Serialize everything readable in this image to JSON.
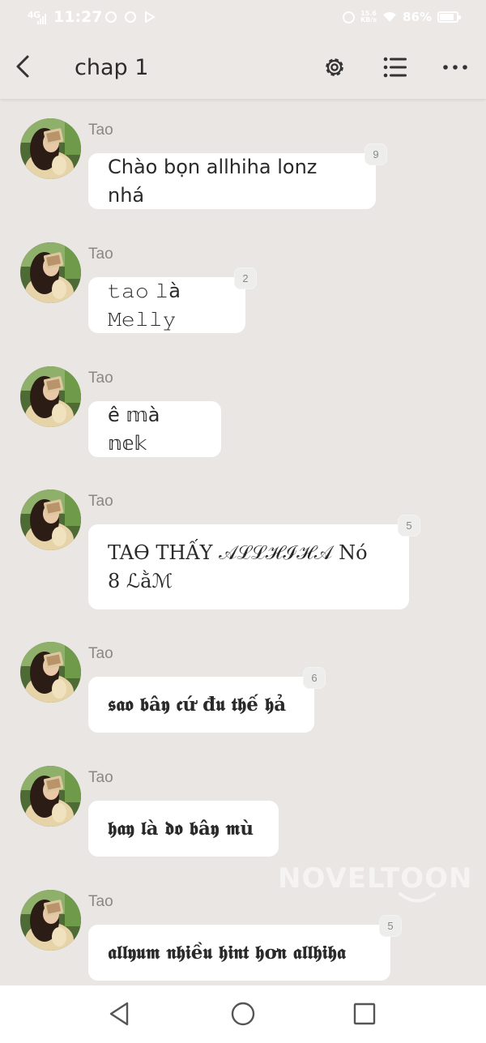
{
  "status_bar": {
    "network": "4G",
    "time": "11:27",
    "speed": "15.6\nKB/s",
    "battery": "86%"
  },
  "header": {
    "title": "chap 1",
    "icons": [
      "back-icon",
      "gear-icon",
      "list-icon",
      "more-icon"
    ]
  },
  "messages": [
    {
      "sender": "Tao",
      "text": "Chào bọn allhiha lonz nhá",
      "comments": "9"
    },
    {
      "sender": "Tao",
      "text": "𝚝𝚊𝚘 𝚕à 𝙼𝚎𝚕𝚕𝚢",
      "comments": "2"
    },
    {
      "sender": "Tao",
      "text": "ê 𝕞à 𝕟𝕖𝕜",
      "comments": ""
    },
    {
      "sender": "Tao",
      "text": "TAƟ THẤY 𝒜ℒℒℋℐℋ𝒜 Nó\n8 ℒằℳ",
      "comments": "5"
    },
    {
      "sender": "Tao",
      "text": "𝖘𝖆𝖔 𝖇â𝖞 𝖈ứ đ𝖚 𝖙𝖍ế 𝖍ả",
      "comments": "6"
    },
    {
      "sender": "Tao",
      "text": "𝖍𝖆𝖞 𝖑à 𝖉𝖔 𝖇â𝖞 𝖒ù",
      "comments": ""
    },
    {
      "sender": "Tao",
      "text": "𝖆𝖑𝖑𝖞𝖚𝖒 𝖓𝖍𝖎ề𝖚 𝖍𝖎𝖓𝖙 𝖍ơ𝖓 𝖆𝖑𝖑𝖍𝖎𝖍𝖆",
      "comments": "5"
    }
  ],
  "watermark": "NOVELTOON",
  "nav_bar": {
    "icons": [
      "nav-back-icon",
      "nav-home-icon",
      "nav-recent-icon"
    ]
  }
}
